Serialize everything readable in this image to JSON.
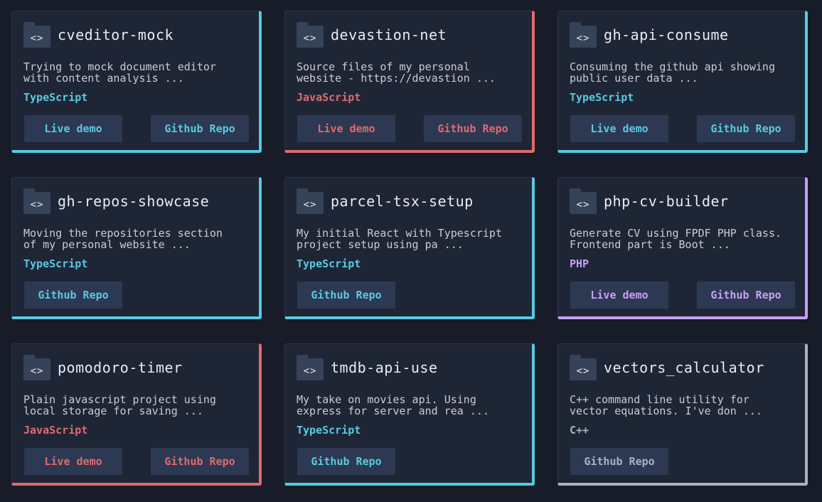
{
  "colors": {
    "typescript": "#5ac9e0",
    "javascript": "#e06a6f",
    "php": "#c6a0f6",
    "cpp": "#a9b1bf"
  },
  "icons": {
    "folder": "folder-code-icon",
    "glyph": "<>"
  },
  "cards": [
    {
      "title": "cveditor-mock",
      "desc": "Trying to mock document editor\nwith content analysis ...",
      "lang": "TypeScript",
      "live": "Live demo",
      "repo": "Github Repo"
    },
    {
      "title": "devastion-net",
      "desc": "Source files of my personal\nwebsite - https://devastion ...",
      "lang": "JavaScript",
      "live": "Live demo",
      "repo": "Github Repo"
    },
    {
      "title": "gh-api-consume",
      "desc": "Consuming the github api showing\npublic user data ...",
      "lang": "TypeScript",
      "live": "Live demo",
      "repo": "Github Repo"
    },
    {
      "title": "gh-repos-showcase",
      "desc": "Moving the repositories section\nof my personal website ...",
      "lang": "TypeScript",
      "repo": "Github Repo"
    },
    {
      "title": "parcel-tsx-setup",
      "desc": "My initial React with Typescript\nproject setup using pa ...",
      "lang": "TypeScript",
      "repo": "Github Repo"
    },
    {
      "title": "php-cv-builder",
      "desc": "Generate CV using FPDF PHP class.\nFrontend part is Boot ...",
      "lang": "PHP",
      "live": "Live demo",
      "repo": "Github Repo"
    },
    {
      "title": "pomodoro-timer",
      "desc": "Plain javascript project using\nlocal storage for saving ...",
      "lang": "JavaScript",
      "live": "Live demo",
      "repo": "Github Repo"
    },
    {
      "title": "tmdb-api-use",
      "desc": "My take on movies api. Using\nexpress for server and rea ...",
      "lang": "TypeScript",
      "repo": "Github Repo"
    },
    {
      "title": "vectors_calculator",
      "desc": "C++ command line utility for\nvector equations. I've don ...",
      "lang": "C++",
      "repo": "Github Repo"
    }
  ]
}
